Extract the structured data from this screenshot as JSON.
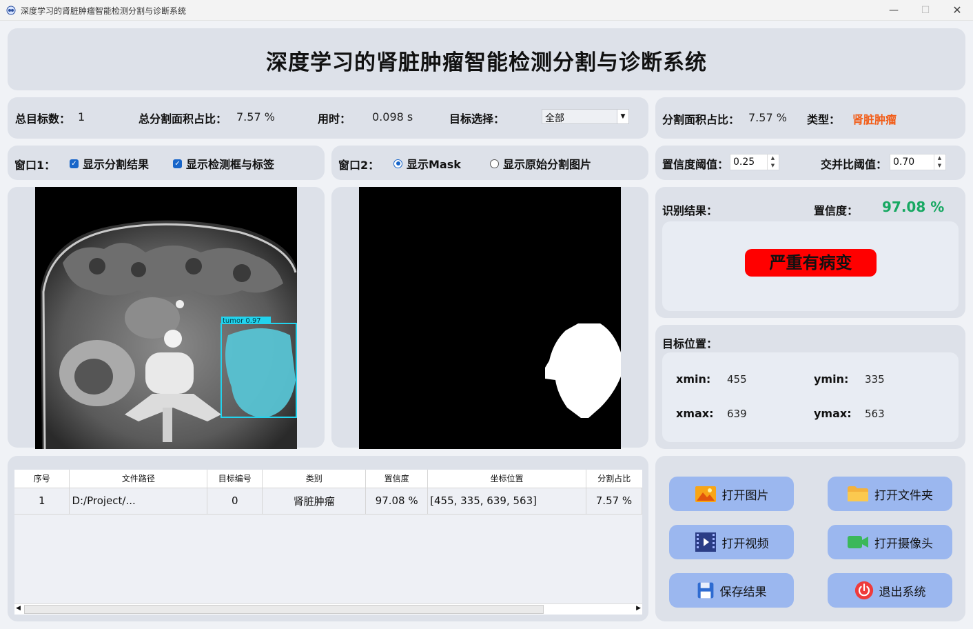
{
  "window": {
    "title": "深度学习的肾脏肿瘤智能检测分割与诊断系统",
    "minimize": "—",
    "maximize": "☐",
    "close": "✕"
  },
  "header": {
    "title": "深度学习的肾脏肿瘤智能检测分割与诊断系统"
  },
  "stats": {
    "total_targets_label": "总目标数：",
    "total_targets": "1",
    "area_ratio_label": "总分割面积占比：",
    "area_ratio": "7.57 %",
    "time_label": "用时：",
    "time": "0.098 s",
    "target_select_label": "目标选择：",
    "target_select_value": "全部"
  },
  "seg_info": {
    "area_label": "分割面积占比：",
    "area": "7.57 %",
    "type_label": "类型：",
    "type": "肾脏肿瘤",
    "type_color": "#f25c17"
  },
  "window1": {
    "label": "窗口1：",
    "show_seg": "显示分割结果",
    "show_box": "显示检测框与标签"
  },
  "window2": {
    "label": "窗口2：",
    "show_mask": "显示Mask",
    "show_orig": "显示原始分割图片"
  },
  "thresholds": {
    "conf_label": "置信度阈值：",
    "conf": "0.25",
    "iou_label": "交并比阈值：",
    "iou": "0.70"
  },
  "detection_label": "tumor  0.97",
  "result": {
    "label": "识别结果：",
    "conf_label": "置信度：",
    "conf": "97.08 %",
    "conf_color": "#17a862",
    "diagnosis": "严重有病变",
    "diagnosis_bg": "#ff0000"
  },
  "position": {
    "label": "目标位置：",
    "xmin_label": "xmin:",
    "xmin": "455",
    "ymin_label": "ymin:",
    "ymin": "335",
    "xmax_label": "xmax:",
    "xmax": "639",
    "ymax_label": "ymax:",
    "ymax": "563"
  },
  "table": {
    "headers": [
      "序号",
      "文件路径",
      "目标编号",
      "类别",
      "置信度",
      "坐标位置",
      "分割占比"
    ],
    "rows": [
      [
        "1",
        "D:/Project/...",
        "0",
        "肾脏肿瘤",
        "97.08 %",
        "[455, 335, 639, 563]",
        "7.57 %"
      ]
    ]
  },
  "buttons": {
    "open_image": "打开图片",
    "open_folder": "打开文件夹",
    "open_video": "打开视频",
    "open_camera": "打开摄像头",
    "save": "保存结果",
    "exit": "退出系统"
  }
}
